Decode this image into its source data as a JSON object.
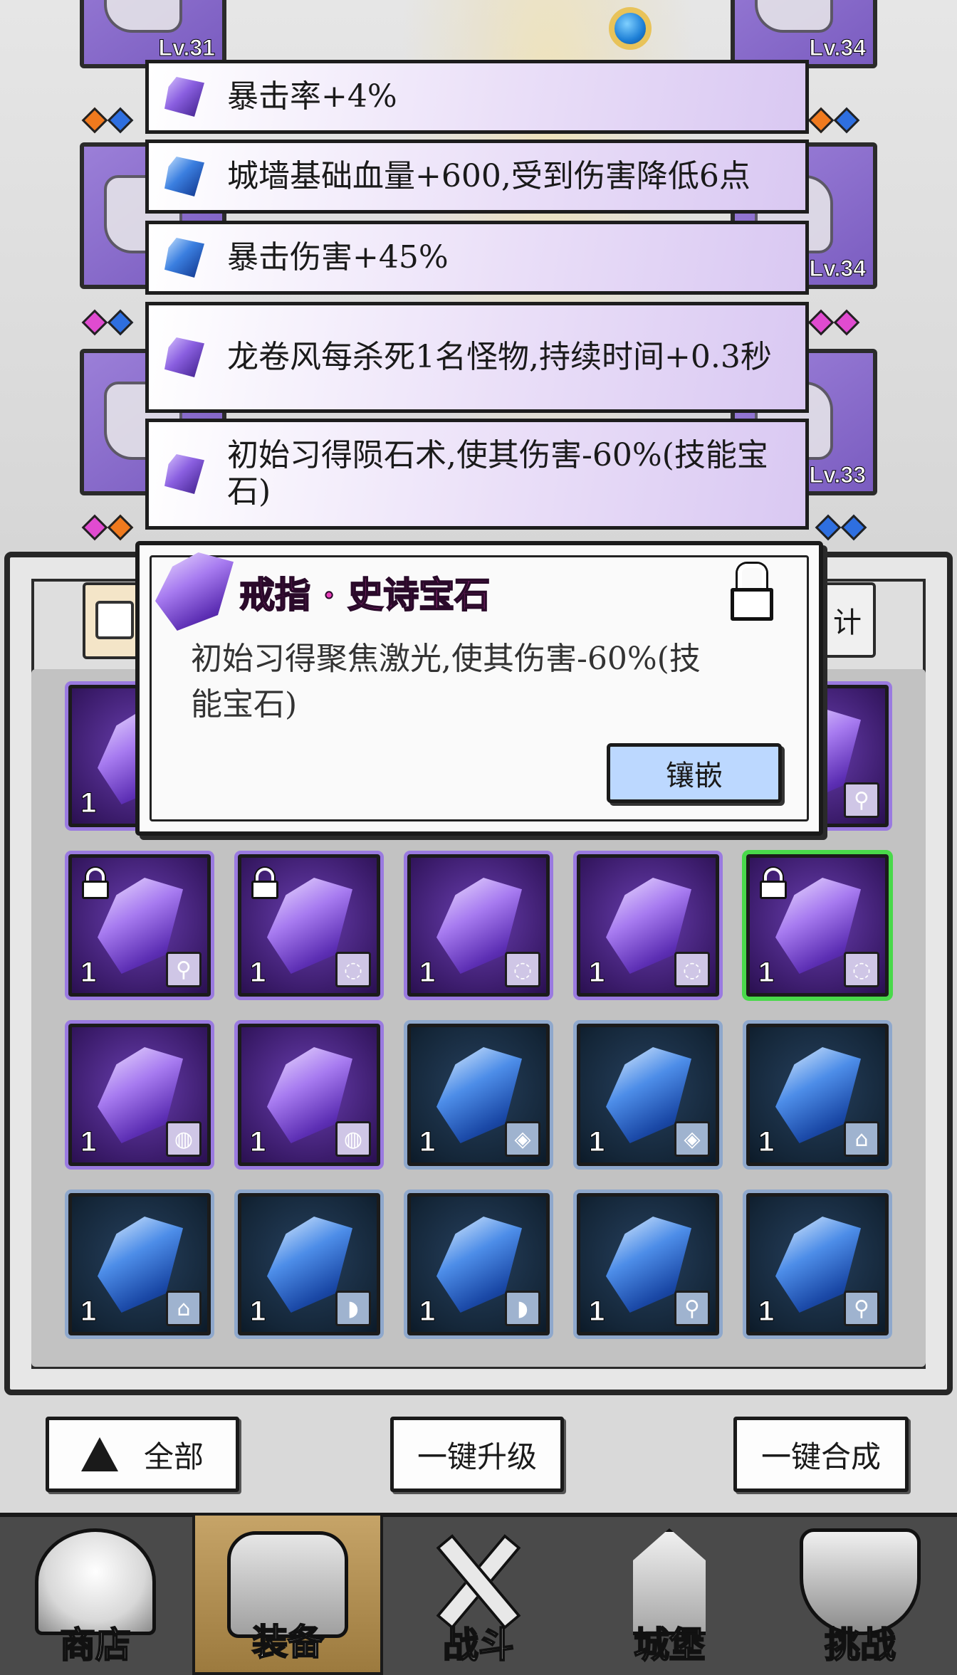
{
  "equipped": {
    "left": [
      {
        "level": "Lv.31"
      },
      {
        "level": ""
      },
      {
        "level": ""
      }
    ],
    "right": [
      {
        "level": "Lv.34"
      },
      {
        "level": "Lv.34"
      },
      {
        "level": "Lv.33"
      }
    ],
    "diamond_colors": {
      "orange": "#f07a1e",
      "blue": "#2e6fe0",
      "pink": "#e04bd0",
      "gray": "#b8b8b8"
    }
  },
  "stat_list": [
    {
      "text": "暴击率+4%",
      "gem": "purple"
    },
    {
      "text": "城墙基础血量+600,受到伤害降低6点",
      "gem": "blue"
    },
    {
      "text": "暴击伤害+45%",
      "gem": "blue"
    },
    {
      "text": "龙卷风每杀死1名怪物,持续时间+0.3秒",
      "gem": "purple"
    },
    {
      "text": "初始习得陨石术,使其伤害-60%(技能宝石)",
      "gem": "purple"
    }
  ],
  "inventory_tab": {
    "right_label": "计"
  },
  "popup": {
    "title": "戒指 · 史诗宝石",
    "description": "初始习得聚焦激光,使其伤害-60%(技能宝石)",
    "embed_label": "镶嵌",
    "lock_icon": "lock-icon"
  },
  "grid": [
    {
      "rarity": "purple",
      "qty": "1",
      "slot_icon": "weapon",
      "locked": false,
      "row": 0,
      "col": 0
    },
    {
      "rarity": "purple",
      "qty": "1",
      "slot_icon": "weapon",
      "locked": false,
      "row": 0,
      "col": 4
    },
    {
      "rarity": "purple",
      "qty": "1",
      "slot_icon": "weapon",
      "locked": true,
      "row": 1,
      "col": 0
    },
    {
      "rarity": "purple",
      "qty": "1",
      "slot_icon": "ring",
      "locked": true,
      "row": 1,
      "col": 1
    },
    {
      "rarity": "purple",
      "qty": "1",
      "slot_icon": "ring",
      "locked": false,
      "row": 1,
      "col": 2
    },
    {
      "rarity": "purple",
      "qty": "1",
      "slot_icon": "ring",
      "locked": false,
      "row": 1,
      "col": 3
    },
    {
      "rarity": "purple",
      "qty": "1",
      "slot_icon": "ring",
      "locked": true,
      "row": 1,
      "col": 4,
      "selected": true
    },
    {
      "rarity": "purple",
      "qty": "1",
      "slot_icon": "necklace",
      "locked": false,
      "row": 2,
      "col": 0
    },
    {
      "rarity": "purple",
      "qty": "1",
      "slot_icon": "necklace",
      "locked": false,
      "row": 2,
      "col": 1
    },
    {
      "rarity": "blue",
      "qty": "1",
      "slot_icon": "armor",
      "locked": false,
      "row": 2,
      "col": 2
    },
    {
      "rarity": "blue",
      "qty": "1",
      "slot_icon": "armor",
      "locked": false,
      "row": 2,
      "col": 3
    },
    {
      "rarity": "blue",
      "qty": "1",
      "slot_icon": "cloak",
      "locked": false,
      "row": 2,
      "col": 4
    },
    {
      "rarity": "blue",
      "qty": "1",
      "slot_icon": "cloak",
      "locked": false,
      "row": 3,
      "col": 0
    },
    {
      "rarity": "blue",
      "qty": "1",
      "slot_icon": "boots",
      "locked": false,
      "row": 3,
      "col": 1
    },
    {
      "rarity": "blue",
      "qty": "1",
      "slot_icon": "boots",
      "locked": false,
      "row": 3,
      "col": 2
    },
    {
      "rarity": "blue",
      "qty": "1",
      "slot_icon": "weapon",
      "locked": false,
      "row": 3,
      "col": 3
    },
    {
      "rarity": "blue",
      "qty": "1",
      "slot_icon": "weapon",
      "locked": false,
      "row": 3,
      "col": 4
    }
  ],
  "actions": {
    "all_label": "全部",
    "upgrade_label": "一键升级",
    "merge_label": "一键合成"
  },
  "nav": [
    {
      "label": "商店",
      "icon": "shop-icon",
      "active": false
    },
    {
      "label": "装备",
      "icon": "backpack-icon",
      "active": true
    },
    {
      "label": "战斗",
      "icon": "crossed-swords-icon",
      "active": false
    },
    {
      "label": "城堡",
      "icon": "castle-icon",
      "active": false
    },
    {
      "label": "挑战",
      "icon": "shield-icon",
      "active": false
    }
  ]
}
